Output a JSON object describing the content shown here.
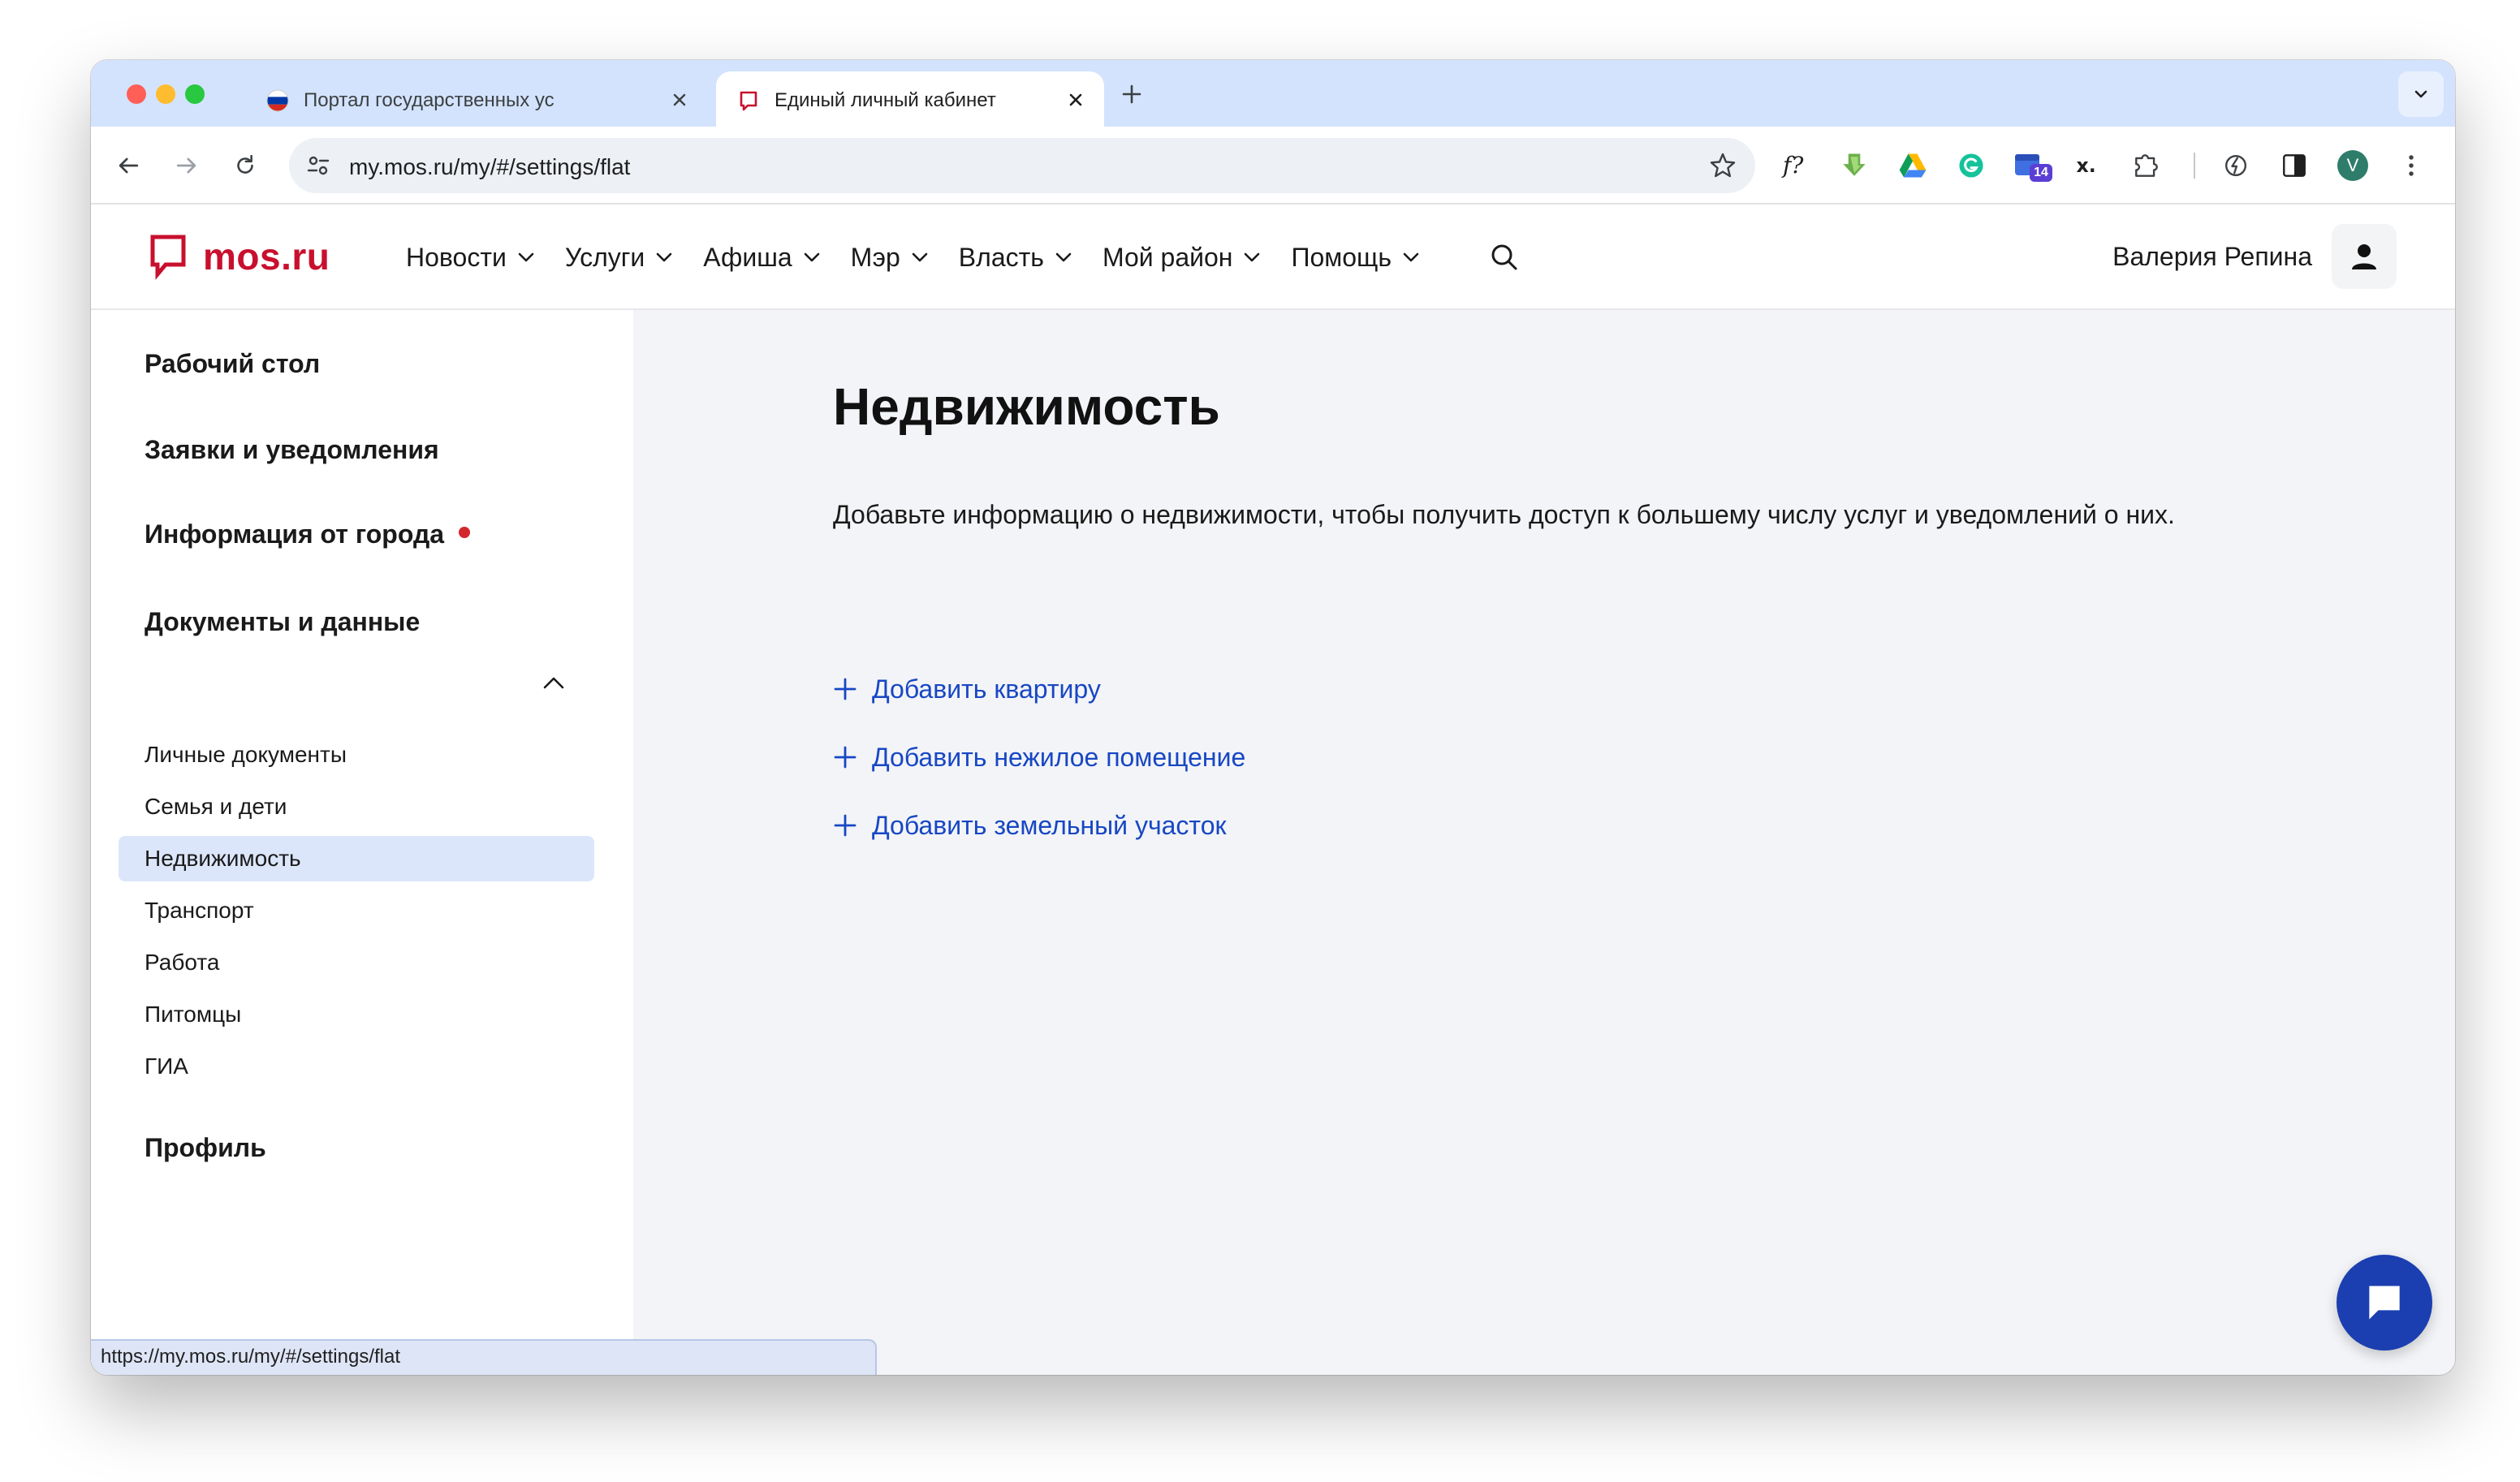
{
  "browser": {
    "tabs": [
      {
        "title": "Портал государственных ус",
        "active": false
      },
      {
        "title": "Единый личный кабинет",
        "active": true
      }
    ],
    "address_url": "my.mos.ru/my/#/settings/flat",
    "extension_badge": "14",
    "profile_initial": "V",
    "status_url": "https://my.mos.ru/my/#/settings/flat"
  },
  "site": {
    "logo_text": "mos.ru",
    "nav": [
      "Новости",
      "Услуги",
      "Афиша",
      "Мэр",
      "Власть",
      "Мой район",
      "Помощь"
    ],
    "user_name": "Валерия Репина"
  },
  "sidebar": {
    "top_items": [
      "Рабочий стол",
      "Заявки и уведомления",
      "Информация от города",
      "Документы и данные"
    ],
    "sub_items": [
      "Личные документы",
      "Семья и дети",
      "Недвижимость",
      "Транспорт",
      "Работа",
      "Питомцы",
      "ГИА"
    ],
    "active_sub_item": "Недвижимость",
    "profile": "Профиль"
  },
  "main": {
    "title": "Недвижимость",
    "description": "Добавьте информацию о недвижимости, чтобы получить доступ к большему числу услуг и уведомлений о них.",
    "add_links": [
      "Добавить квартиру",
      "Добавить нежилое помещение",
      "Добавить земельный участок"
    ]
  },
  "colors": {
    "brand_red": "#c8102e",
    "link_blue": "#1747c4",
    "active_item_bg": "#dce6fb",
    "chat_button": "#1b3fb0"
  }
}
